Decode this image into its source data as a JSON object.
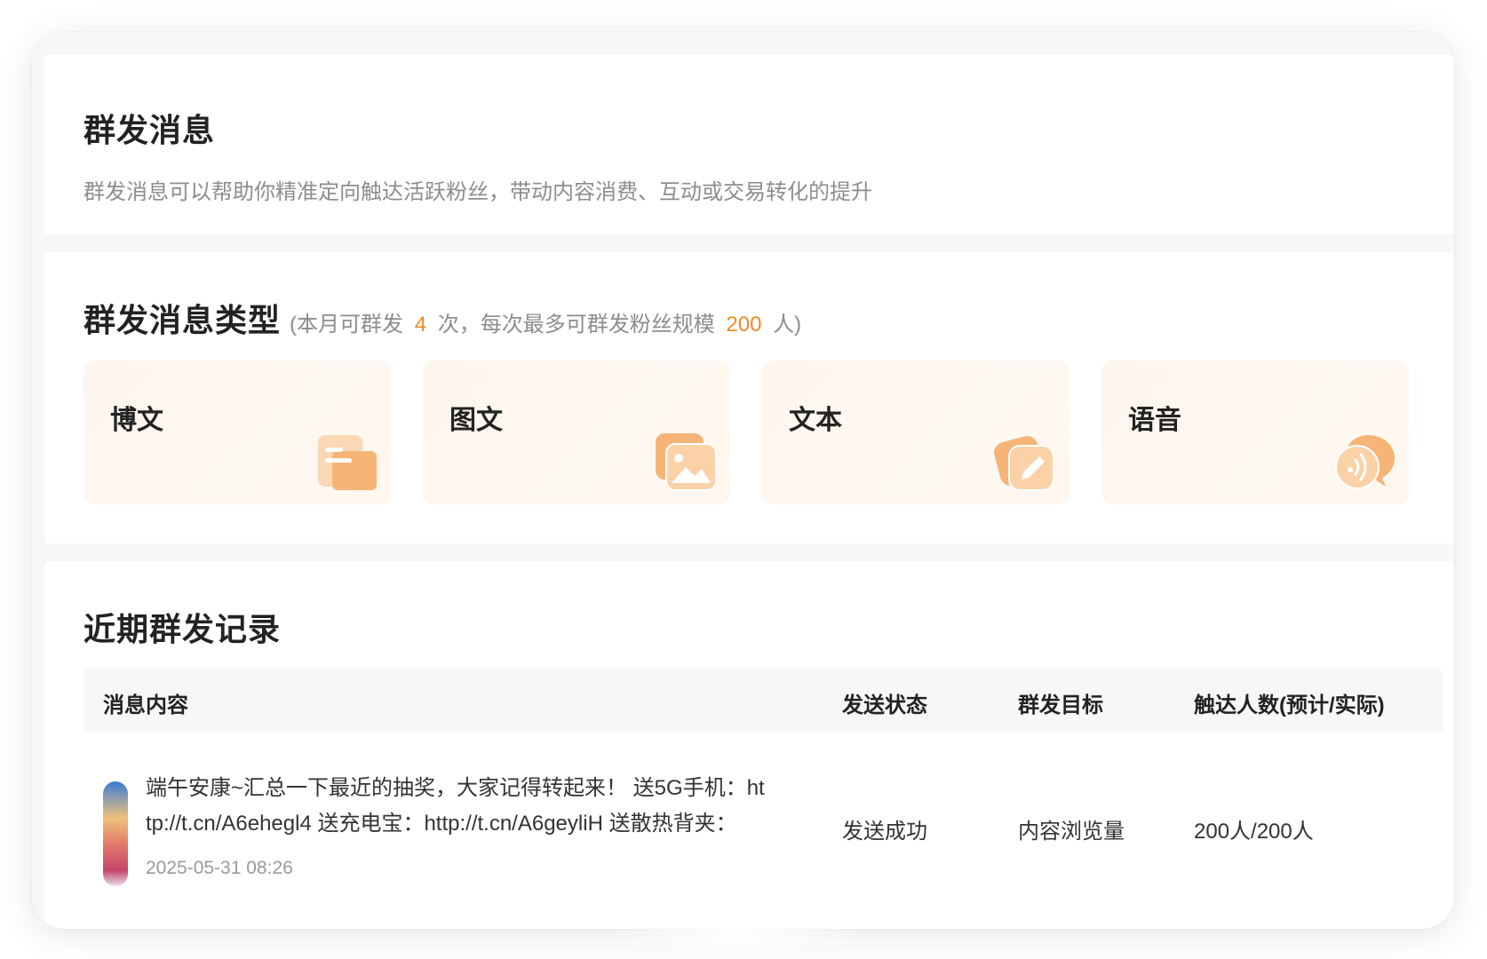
{
  "header": {
    "title": "群发消息",
    "description": "群发消息可以帮助你精准定向触达活跃粉丝，带动内容消费、互动或交易转化的提升"
  },
  "types": {
    "title": "群发消息类型",
    "quota_prefix": "(本月可群发",
    "quota_times": "4",
    "quota_mid": "次，每次最多可群发粉丝规模",
    "quota_fans": "200",
    "quota_suffix": "人)",
    "cards": [
      {
        "label": "博文",
        "icon": "document-icon"
      },
      {
        "label": "图文",
        "icon": "image-icon"
      },
      {
        "label": "文本",
        "icon": "pencil-icon"
      },
      {
        "label": "语音",
        "icon": "voice-bubble-icon"
      }
    ]
  },
  "records": {
    "title": "近期群发记录",
    "columns": [
      "消息内容",
      "发送状态",
      "群发目标",
      "触达人数(预计/实际)"
    ],
    "rows": [
      {
        "content_line1": "端午安康~汇总一下最近的抽奖，大家记得转起来！ 送5G手机：ht",
        "content_line2": "tp://t.cn/A6ehegl4 送充电宝：http://t.cn/A6geyliH 送散热背夹：",
        "time": "2025-05-31 08:26",
        "status": "发送成功",
        "target": "内容浏览量",
        "reach": "200人/200人"
      }
    ]
  },
  "colors": {
    "accent": "#ef8a2a",
    "card_bg": "#fdf6ee",
    "icon_main": "#f6b577"
  }
}
